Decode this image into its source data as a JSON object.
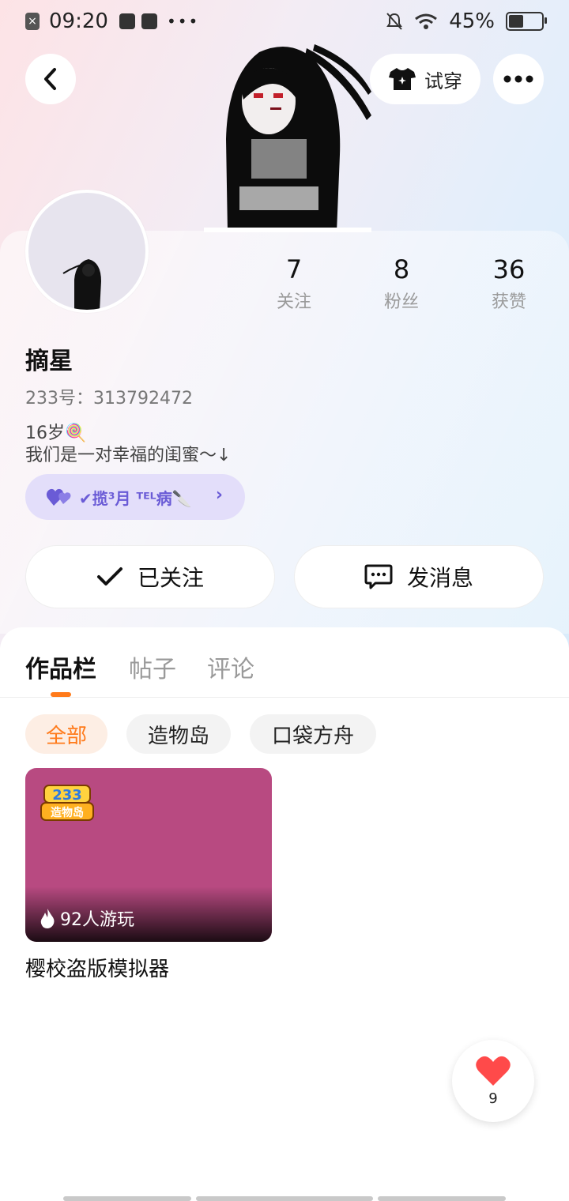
{
  "status_bar": {
    "time": "09:20",
    "battery": "45%",
    "battery_level": 0.45
  },
  "header": {
    "tryon_label": "试穿"
  },
  "stats": [
    {
      "num": "7",
      "label": "关注"
    },
    {
      "num": "8",
      "label": "粉丝"
    },
    {
      "num": "36",
      "label": "获赞"
    }
  ],
  "profile": {
    "nickname": "摘星",
    "uid": "233号：313792472",
    "bio_line1": "16岁🍭",
    "bio_line2": "我们是一对幸福的闺蜜～↓",
    "family_label": "✔揽³月 ᵀᴱᴸ病🔪"
  },
  "actions": {
    "followed_label": "已关注",
    "message_label": "发消息"
  },
  "tabs": [
    {
      "label": "作品栏"
    },
    {
      "label": "帖子"
    },
    {
      "label": "评论"
    }
  ],
  "chips": [
    {
      "label": "全部"
    },
    {
      "label": "造物岛"
    },
    {
      "label": "口袋方舟"
    }
  ],
  "works": [
    {
      "logo_text": "233",
      "logo_sub": "造物岛",
      "plays": "92人游玩",
      "title": "樱校盗版模拟器"
    }
  ],
  "like": {
    "count": "9"
  },
  "colors": {
    "accent": "#ff7a1a",
    "family_purple": "#6a5bd6",
    "card_magenta": "#b84a81"
  }
}
